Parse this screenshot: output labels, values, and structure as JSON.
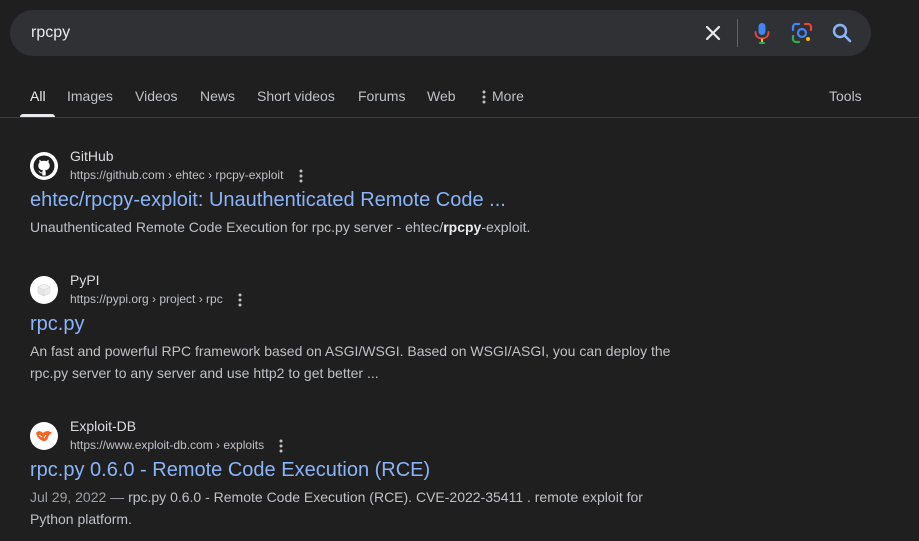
{
  "search": {
    "query": "rpcpy",
    "clear_icon": "close-icon",
    "voice_icon": "microphone-icon",
    "lens_icon": "camera-lens-icon",
    "search_icon": "search-icon",
    "colors": {
      "mic_blue": "#4285f4",
      "mic_red": "#ea4335",
      "lens_yellow": "#fbbc04",
      "lens_green": "#34a853",
      "search_blue": "#8ab4f8"
    }
  },
  "tabs": {
    "items": [
      {
        "label": "All",
        "active": true
      },
      {
        "label": "Images"
      },
      {
        "label": "Videos"
      },
      {
        "label": "News"
      },
      {
        "label": "Short videos"
      },
      {
        "label": "Forums"
      },
      {
        "label": "Web"
      }
    ],
    "more_label": "More",
    "tools_label": "Tools"
  },
  "results": [
    {
      "site_name": "GitHub",
      "url": "https://github.com › ehtec › rpcpy-exploit",
      "title": "ehtec/rpcpy-exploit: Unauthenticated Remote Code ...",
      "snippet_before": "Unauthenticated Remote Code Execution for rpc.py server - ehtec/",
      "snippet_bold": "rpcpy",
      "snippet_after": "-exploit.",
      "favicon": "github-icon"
    },
    {
      "site_name": "PyPI",
      "url": "https://pypi.org › project › rpc",
      "title": "rpc.py",
      "snippet_line1": "An fast and powerful RPC framework based on ASGI/WSGI. Based on WSGI/ASGI, you can deploy the",
      "snippet_line2": "rpc.py server to any server and use http2 to get better ...",
      "favicon": "pypi-icon"
    },
    {
      "site_name": "Exploit-DB",
      "url": "https://www.exploit-db.com › exploits",
      "title": "rpc.py 0.6.0 - Remote Code Execution (RCE)",
      "date": "Jul 29, 2022 —",
      "snippet_line1": "rpc.py 0.6.0 - Remote Code Execution (RCE). CVE-2022-35411 . remote exploit for",
      "snippet_line2": "Python platform.",
      "favicon": "exploit-db-icon"
    }
  ]
}
